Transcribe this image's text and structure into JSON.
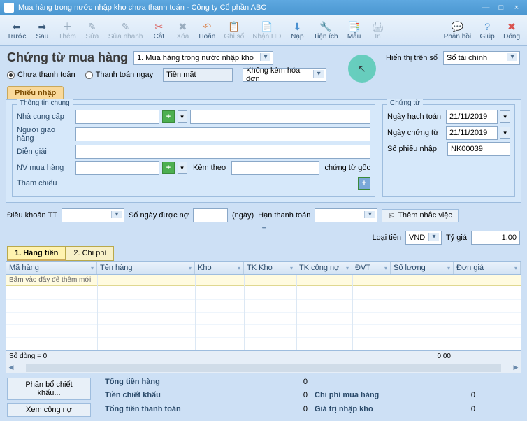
{
  "window": {
    "title": "Mua hàng trong nước nhập kho chưa thanh toán - Công ty Cổ phần ABC"
  },
  "toolbar": {
    "prev": "Trước",
    "next": "Sau",
    "add": "Thêm",
    "edit": "Sửa",
    "quickedit": "Sửa nhanh",
    "cut": "Cắt",
    "del": "Xóa",
    "undo": "Hoãn",
    "write": "Ghi sổ",
    "receive": "Nhận HĐ",
    "load": "Nạp",
    "util": "Tiện ích",
    "template": "Mẫu",
    "print": "In",
    "feedback": "Phản hồi",
    "help": "Giúp",
    "close": "Đóng"
  },
  "header": {
    "title": "Chứng từ mua hàng",
    "type_value": "1. Mua hàng trong nước nhập kho",
    "display_label": "Hiển thị trên sổ",
    "display_value": "Sổ tài chính"
  },
  "payment": {
    "unpaid": "Chưa thanh toán",
    "paynow": "Thanh toán ngay",
    "method": "Tiền mặt",
    "invoice": "Không kèm hóa đơn"
  },
  "tab": {
    "entry": "Phiếu nhập"
  },
  "general": {
    "group": "Thông tin chung",
    "supplier": "Nhà cung cấp",
    "deliverer": "Người giao hàng",
    "desc": "Diễn giải",
    "buyer": "NV mua hàng",
    "attach_label": "Kèm theo",
    "attach_suffix": "chứng từ gốc",
    "ref": "Tham chiếu"
  },
  "voucher": {
    "group": "Chứng từ",
    "acc_date_label": "Ngày hạch toán",
    "acc_date": "21/11/2019",
    "doc_date_label": "Ngày chứng từ",
    "doc_date": "21/11/2019",
    "no_label": "Số phiếu nhập",
    "no": "NK00039"
  },
  "mid": {
    "terms": "Điều khoản TT",
    "days_label": "Số ngày được nợ",
    "days_unit": "(ngày)",
    "due_label": "Hạn thanh toán",
    "reminder": "Thêm nhắc việc"
  },
  "currency": {
    "label": "Loại tiền",
    "value": "VND",
    "rate_label": "Tỷ giá",
    "rate": "1,00"
  },
  "grid": {
    "tab1": "1. Hàng tiền",
    "tab2": "2. Chi phí",
    "cols": {
      "code": "Mã hàng",
      "name": "Tên hàng",
      "wh": "Kho",
      "acc": "TK Kho",
      "debt": "TK công nợ",
      "unit": "ĐVT",
      "qty": "Số lượng",
      "price": "Đơn giá"
    },
    "placeholder": "Bấm vào đây để thêm mới",
    "rowcount": "Số dòng = 0",
    "sum": "0,00"
  },
  "bottom": {
    "alloc": "Phân bổ chiết khấu...",
    "debt": "Xem công nợ",
    "total_goods": "Tổng tiền hàng",
    "discount": "Tiền chiết khấu",
    "total_pay": "Tổng tiền thanh toán",
    "cost": "Chi phí mua hàng",
    "value": "Giá trị nhập kho",
    "zero": "0"
  }
}
